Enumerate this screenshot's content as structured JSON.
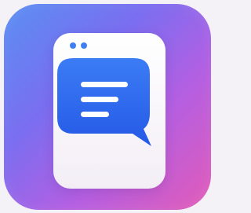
{
  "icon": {
    "name": "messaging-app-icon",
    "colors": {
      "background_gradient": [
        "#5a8ff2",
        "#7a6ef0",
        "#b45fe2",
        "#e25bb8"
      ],
      "card": "#ffffff",
      "bubble": "#2f6ff0",
      "dots": "#3f7ff3",
      "lines": "#ffffff"
    },
    "symbols": [
      "window-card",
      "chat-bubble-icon",
      "text-lines"
    ]
  }
}
